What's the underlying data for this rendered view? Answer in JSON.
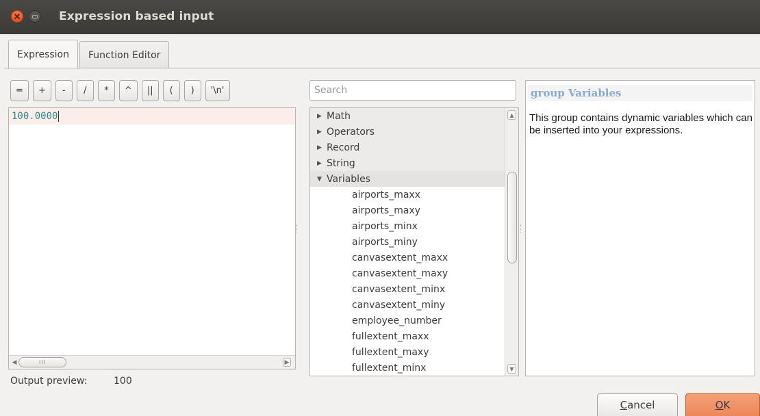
{
  "window": {
    "title": "Expression based input"
  },
  "tabs": [
    {
      "label": "Expression",
      "active": true
    },
    {
      "label": "Function Editor",
      "active": false
    }
  ],
  "operators": [
    "=",
    "+",
    "-",
    "/",
    "*",
    "^",
    "||",
    "(",
    ")",
    "'\\n'"
  ],
  "editor": {
    "text": "100.0000"
  },
  "hscroll": {
    "thumb_grip": "III"
  },
  "preview": {
    "label": "Output preview:",
    "value": "100"
  },
  "search": {
    "placeholder": "Search",
    "value": ""
  },
  "tree": {
    "groups": [
      {
        "label": "Math",
        "expanded": false
      },
      {
        "label": "Operators",
        "expanded": false
      },
      {
        "label": "Record",
        "expanded": false
      },
      {
        "label": "String",
        "expanded": false
      },
      {
        "label": "Variables",
        "expanded": true
      }
    ],
    "variables": [
      "airports_maxx",
      "airports_maxy",
      "airports_minx",
      "airports_miny",
      "canvasextent_maxx",
      "canvasextent_maxy",
      "canvasextent_minx",
      "canvasextent_miny",
      "employee_number",
      "fullextent_maxx",
      "fullextent_maxy",
      "fullextent_minx"
    ]
  },
  "help": {
    "title": "group Variables",
    "body": "This group contains dynamic variables which can be inserted into your expressions."
  },
  "buttons": {
    "cancel": {
      "mnemonic": "C",
      "rest": "ancel"
    },
    "ok": {
      "mnemonic": "O",
      "rest": "K"
    }
  },
  "colors": {
    "titlebar": "#3b3a36",
    "close_button": "#e0501e",
    "ok_button": "#ec8759",
    "help_title": "#8aaad0",
    "editor_text": "#2a8a8a",
    "editor_line_highlight": "#fbeeea"
  }
}
